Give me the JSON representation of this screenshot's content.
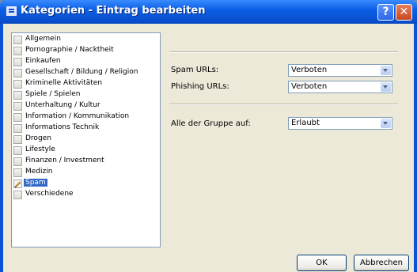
{
  "window": {
    "title": "Kategorien - Eintrag bearbeiten",
    "help_label": "?",
    "close_label": "✕"
  },
  "categories": [
    {
      "label": "Allgemein"
    },
    {
      "label": "Pornographie / Nacktheit"
    },
    {
      "label": "Einkaufen"
    },
    {
      "label": "Gesellschaft / Bildung / Religion"
    },
    {
      "label": "Kriminelle Aktivitäten"
    },
    {
      "label": "Spiele / Spielen"
    },
    {
      "label": "Unterhaltung / Kultur"
    },
    {
      "label": "Information / Kommunikation"
    },
    {
      "label": "Informations Technik"
    },
    {
      "label": "Drogen"
    },
    {
      "label": "Lifestyle"
    },
    {
      "label": "Finanzen / Investment"
    },
    {
      "label": "Medizin"
    },
    {
      "label": "Spam",
      "selected": true
    },
    {
      "label": "Verschiedene"
    }
  ],
  "settings": {
    "spam_urls": {
      "label": "Spam URLs:",
      "value": "Verboten"
    },
    "phishing_urls": {
      "label": "Phishing URLs:",
      "value": "Verboten"
    },
    "all_group": {
      "label": "Alle der Gruppe auf:",
      "value": "Erlaubt"
    }
  },
  "buttons": {
    "ok": "OK",
    "cancel": "Abbrechen"
  }
}
